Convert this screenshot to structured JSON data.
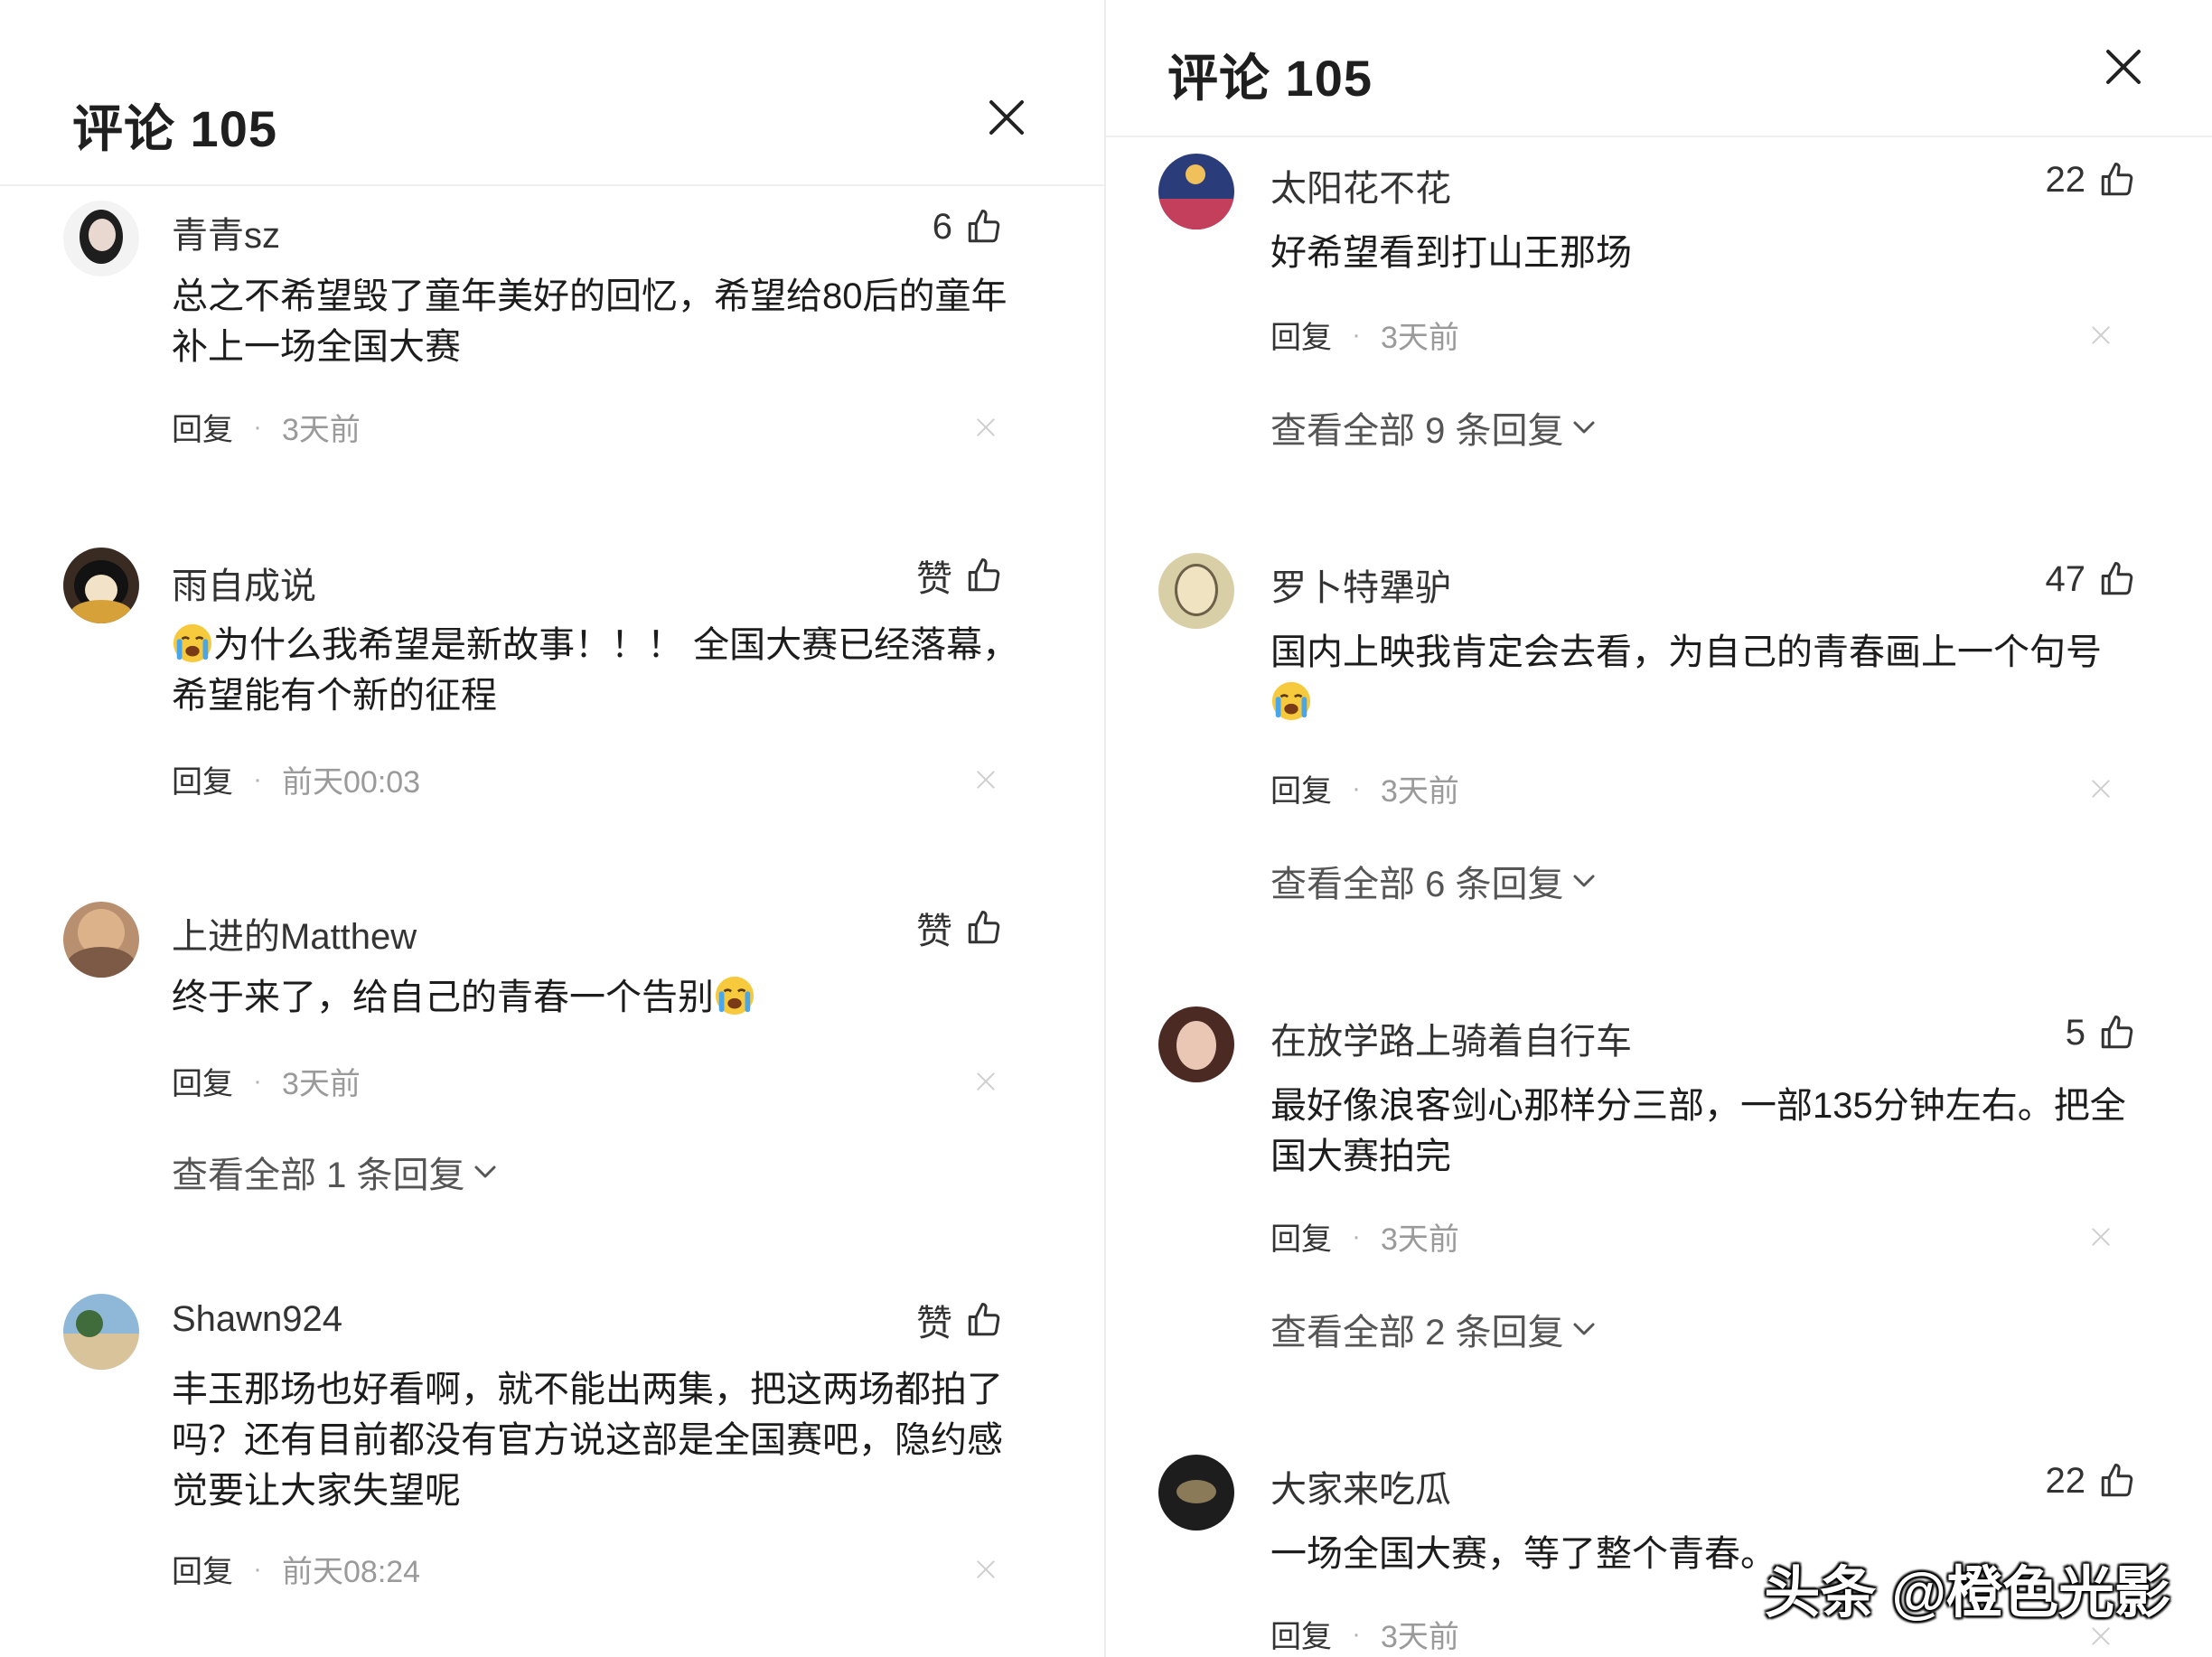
{
  "left_panel": {
    "title": "评论 105",
    "comments": [
      {
        "username": "青青sz",
        "likes": "6",
        "text_lines": [
          "总之不希望毁了童年美好的回忆，希望给80后的童年",
          "补上一场全国大赛"
        ],
        "reply_label": "回复",
        "time": "3天前"
      },
      {
        "username": "雨自成说",
        "likes": "赞",
        "text_lines": [
          "为什么我希望是新故事！！！ 全国大赛已经落幕，",
          "希望能有个新的征程"
        ],
        "reply_label": "回复",
        "time": "前天00:03"
      },
      {
        "username": "上进的Matthew",
        "likes": "赞",
        "text_lines": [
          "终于来了，给自己的青春一个告别"
        ],
        "reply_label": "回复",
        "time": "3天前",
        "view_replies": "查看全部 1 条回复"
      },
      {
        "username": "Shawn924",
        "likes": "赞",
        "text_lines": [
          "丰玉那场也好看啊，就不能出两集，把这两场都拍了",
          "吗？还有目前都没有官方说这部是全国赛吧，隐约感",
          "觉要让大家失望呢"
        ],
        "reply_label": "回复",
        "time": "前天08:24"
      }
    ]
  },
  "right_panel": {
    "title": "评论 105",
    "comments": [
      {
        "username": "太阳花不花",
        "likes": "22",
        "text_lines": [
          "好希望看到打山王那场"
        ],
        "reply_label": "回复",
        "time": "3天前",
        "view_replies": "查看全部 9 条回复"
      },
      {
        "username": "罗卜特犟驴",
        "likes": "47",
        "text_lines": [
          "国内上映我肯定会去看，为自己的青春画上一个句号"
        ],
        "reply_label": "回复",
        "time": "3天前",
        "view_replies": "查看全部 6 条回复"
      },
      {
        "username": "在放学路上骑着自行车",
        "likes": "5",
        "text_lines": [
          "最好像浪客剑心那样分三部，一部135分钟左右。把全",
          "国大赛拍完"
        ],
        "reply_label": "回复",
        "time": "3天前",
        "view_replies": "查看全部 2 条回复"
      },
      {
        "username": "大家来吃瓜",
        "likes": "22",
        "text_lines": [
          "一场全国大赛，等了整个青春。"
        ],
        "reply_label": "回复",
        "time": "3天前"
      }
    ]
  },
  "watermark": "头条 @橙色光影",
  "icons": {
    "close": "close-icon",
    "like": "thumb-up-icon",
    "dismiss": "dismiss-icon",
    "expand": "chevron-down-icon",
    "emoji": "crying-emoji-icon"
  },
  "colors": {
    "background": "#ffffff",
    "text_primary": "#1c1c1c",
    "text_meta": "#9a9a9a",
    "divider": "#efefef"
  }
}
